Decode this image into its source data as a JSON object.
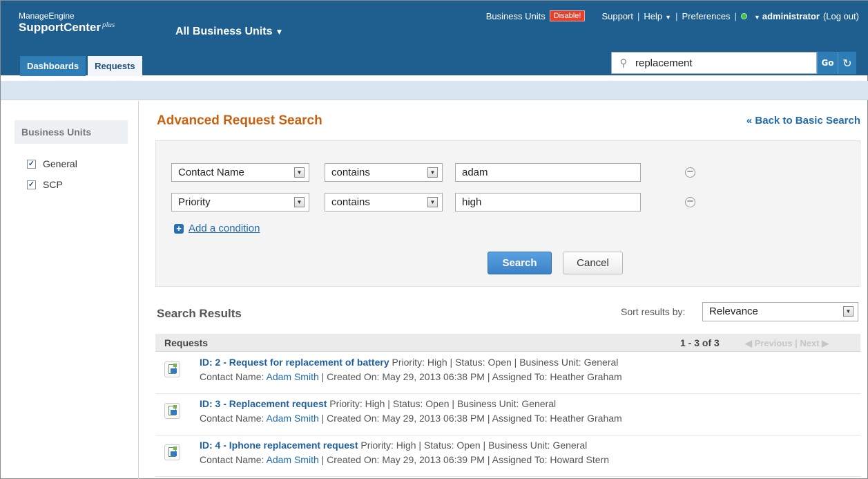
{
  "header": {
    "brand_top": "ManageEngine",
    "brand_main": "SupportCenter",
    "brand_sup": "plus",
    "business_unit": "All Business Units",
    "business_units_label": "Business Units",
    "disable_badge": "Disable!",
    "support": "Support",
    "help": "Help",
    "preferences": "Preferences",
    "user": "administrator",
    "logout": "(Log out)",
    "tabs": [
      {
        "label": "Dashboards"
      },
      {
        "label": "Requests"
      }
    ],
    "search_value": "replacement",
    "go_label": "Go"
  },
  "sidebar": {
    "title": "Business Units",
    "items": [
      {
        "label": "General"
      },
      {
        "label": "SCP"
      }
    ]
  },
  "main": {
    "title": "Advanced Request Search",
    "back_link": "« Back to Basic Search",
    "conditions": [
      {
        "field": "Contact Name",
        "operator": "contains",
        "value": "adam"
      },
      {
        "field": "Priority",
        "operator": "contains",
        "value": "high"
      }
    ],
    "add_condition": "Add a condition",
    "search_button": "Search",
    "cancel_button": "Cancel"
  },
  "results": {
    "title": "Search Results",
    "sort_label": "Sort results by:",
    "sort_value": "Relevance",
    "bar_label": "Requests",
    "count": "1 - 3 of 3",
    "pager": "◀ Previous | Next ▶",
    "rows": [
      {
        "title": "ID: 2 - Request for replacement of battery",
        "meta": "Priority: High  |  Status: Open   |  Business Unit: General",
        "contact_label": "Contact Name: ",
        "contact": "Adam Smith",
        "details": "  |  Created On: May 29, 2013 06:38 PM  |  Assigned To: Heather Graham"
      },
      {
        "title": "ID: 3 - Replacement request",
        "meta": "Priority: High  |  Status: Open   |  Business Unit: General",
        "contact_label": "Contact Name: ",
        "contact": "Adam Smith",
        "details": "  |  Created On: May 29, 2013 06:38 PM  |  Assigned To: Heather Graham"
      },
      {
        "title": "ID: 4 - Iphone replacement request",
        "meta": "Priority: High  |  Status: Open   |  Business Unit: General",
        "contact_label": "Contact Name: ",
        "contact": "Adam Smith",
        "details": "  |  Created On: May 29, 2013 06:39 PM  |  Assigned To: Howard Stern"
      }
    ]
  }
}
